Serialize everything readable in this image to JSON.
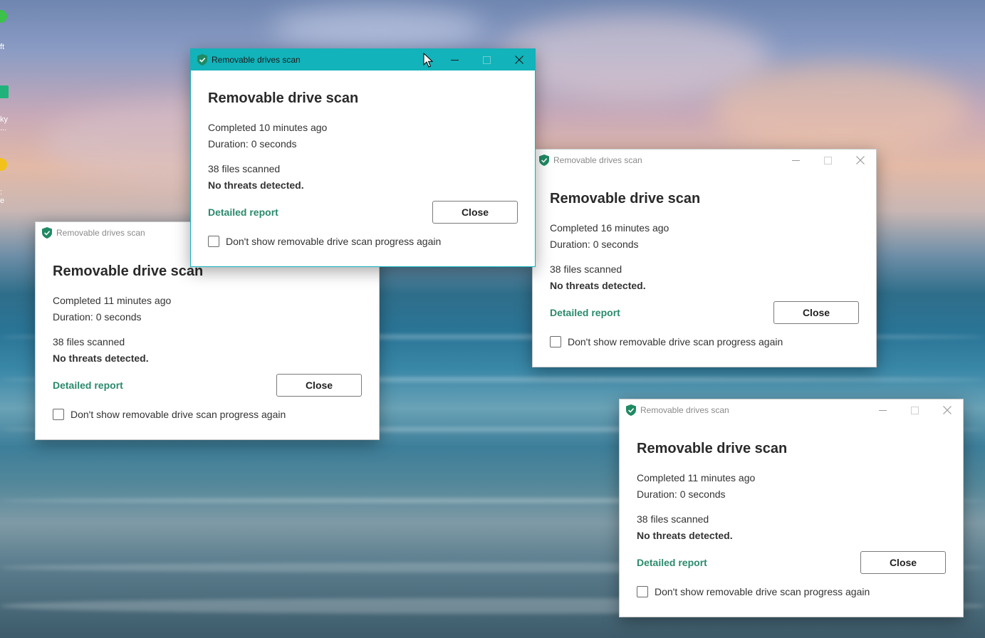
{
  "desktop": {
    "icons": [
      {
        "label": "ft",
        "icon": "app-icon-green"
      },
      {
        "label": "ky\n...",
        "icon": "app-icon-teal"
      },
      {
        "label": ":\ne",
        "icon": "app-icon-yellow"
      }
    ]
  },
  "colors": {
    "accent": "#12b3ba",
    "link": "#2b8a6d",
    "shield": "#1f8a63"
  },
  "windows": [
    {
      "title": "Removable drives scan",
      "heading": "Removable drive scan",
      "completed": "Completed 11 minutes ago",
      "duration": "Duration: 0 seconds",
      "files": "38 files scanned",
      "result": "No threats detected.",
      "report_label": "Detailed report",
      "close_label": "Close",
      "checkbox_label": "Don't show removable drive scan progress again",
      "active": false
    },
    {
      "title": "Removable drives scan",
      "heading": "Removable drive scan",
      "completed": "Completed 16 minutes ago",
      "duration": "Duration: 0 seconds",
      "files": "38 files scanned",
      "result": "No threats detected.",
      "report_label": "Detailed report",
      "close_label": "Close",
      "checkbox_label": "Don't show removable drive scan progress again",
      "active": false
    },
    {
      "title": "Removable drives scan",
      "heading": "Removable drive scan",
      "completed": "Completed 11 minutes ago",
      "duration": "Duration: 0 seconds",
      "files": "38 files scanned",
      "result": "No threats detected.",
      "report_label": "Detailed report",
      "close_label": "Close",
      "checkbox_label": "Don't show removable drive scan progress again",
      "active": false
    },
    {
      "title": "Removable drives scan",
      "heading": "Removable drive scan",
      "completed": "Completed 10 minutes ago",
      "duration": "Duration: 0 seconds",
      "files": "38 files scanned",
      "result": "No threats detected.",
      "report_label": "Detailed report",
      "close_label": "Close",
      "checkbox_label": "Don't show removable drive scan progress again",
      "active": true
    }
  ]
}
